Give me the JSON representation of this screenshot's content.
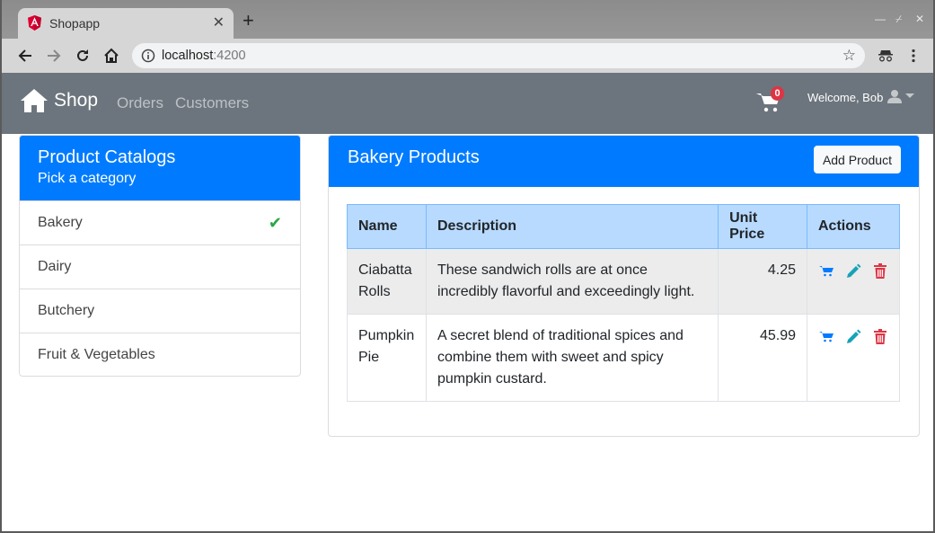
{
  "browser": {
    "tab_title": "Shopapp",
    "favicon": "angular-icon",
    "new_tab_icon": "plus-icon",
    "url_host": "localhost",
    "url_port": ":4200",
    "toolbar_icons": [
      "back-icon",
      "forward-icon",
      "reload-icon",
      "home-icon",
      "info-icon",
      "star-icon",
      "incognito-icon",
      "menu-icon"
    ]
  },
  "navbar": {
    "brand": "Shop",
    "links": [
      "Orders",
      "Customers"
    ],
    "cart_count": "0",
    "welcome": "Welcome, Bob"
  },
  "catalog": {
    "title": "Product Catalogs",
    "subtitle": "Pick a category",
    "items": [
      {
        "label": "Bakery",
        "selected": true
      },
      {
        "label": "Dairy",
        "selected": false
      },
      {
        "label": "Butchery",
        "selected": false
      },
      {
        "label": "Fruit & Vegetables",
        "selected": false
      }
    ]
  },
  "products": {
    "title": "Bakery Products",
    "add_button": "Add Product",
    "columns": [
      "Name",
      "Description",
      "Unit Price",
      "Actions"
    ],
    "rows": [
      {
        "name": "Ciabatta Rolls",
        "description": "These sandwich rolls are at once incredibly flavorful and exceedingly light.",
        "price": "4.25"
      },
      {
        "name": "Pumpkin Pie",
        "description": "A secret blend of traditional spices and combine them with sweet and spicy pumpkin custard.",
        "price": "45.99"
      }
    ]
  },
  "colors": {
    "primary": "#007bff",
    "navbar": "#6c757d",
    "success": "#28a745",
    "info": "#17a2b8",
    "danger": "#dc3545",
    "table_head": "#b8daff"
  }
}
